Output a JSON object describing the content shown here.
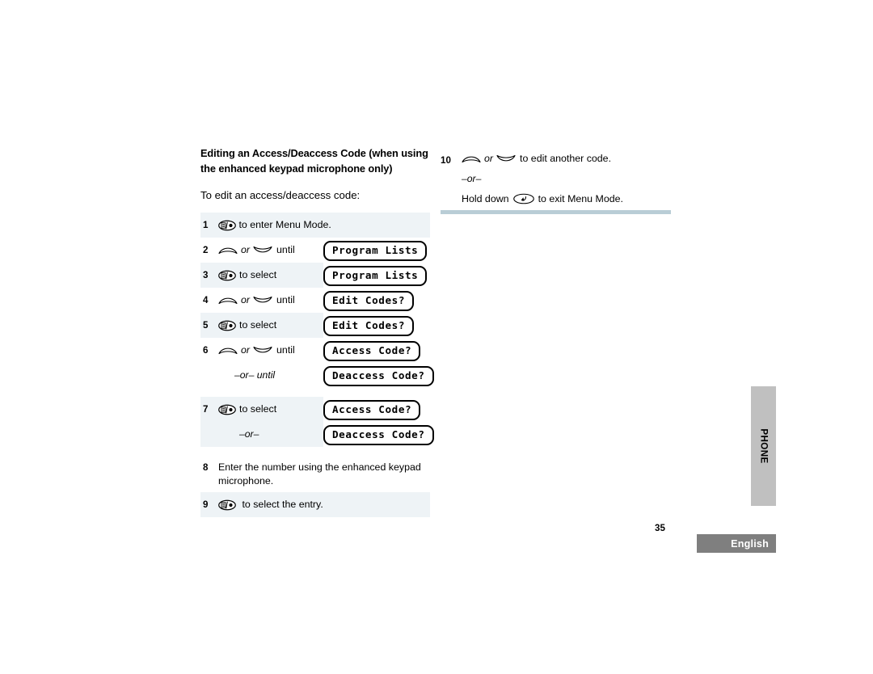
{
  "section": {
    "title": "Editing an Access/Deaccess Code (when using the enhanced keypad microphone only)",
    "intro": "To edit an access/deaccess code:"
  },
  "icons": {
    "menu_select": "menu-select-key-icon",
    "up": "up-arrow-key-icon",
    "down": "down-arrow-key-icon",
    "back": "back-exit-key-icon"
  },
  "labels": {
    "or_italic": "or",
    "or_dash": "–or–",
    "or_dash_until": "until"
  },
  "steps": [
    {
      "num": "1",
      "icon": "menu-select-key-icon",
      "text": "to enter Menu Mode.",
      "shaded": true,
      "full": true,
      "display": null
    },
    {
      "num": "2",
      "icon": "updown",
      "text": "until",
      "shaded": false,
      "display": "Program Lists"
    },
    {
      "num": "3",
      "icon": "menu-select-key-icon",
      "text": "to select",
      "shaded": true,
      "display": "Program Lists"
    },
    {
      "num": "4",
      "icon": "updown",
      "text": "until",
      "shaded": false,
      "display": "Edit Codes?"
    },
    {
      "num": "5",
      "icon": "menu-select-key-icon",
      "text": "to select",
      "shaded": true,
      "display": "Edit Codes?"
    },
    {
      "num": "6",
      "icon": "updown",
      "text": "until",
      "shaded": false,
      "display": "Access Code?",
      "alt_label": "–or– until",
      "alt_display": "Deaccess Code?"
    },
    {
      "num": "7",
      "icon": "menu-select-key-icon",
      "text": "to select",
      "shaded": true,
      "display": "Access Code?",
      "alt_label": "–or–",
      "alt_display": "Deaccess Code?"
    },
    {
      "num": "8",
      "icon": null,
      "text": "Enter the number using the enhanced keypad microphone.",
      "shaded": false,
      "full": true,
      "display": null
    },
    {
      "num": "9",
      "icon": "menu-select-key-icon",
      "text": "to select the entry.",
      "shaded": true,
      "full": true,
      "display": null
    }
  ],
  "right": {
    "num": "10",
    "text": "to edit another code.",
    "or_dash": "–or–",
    "hold_prefix": "Hold down",
    "hold_suffix": "to exit Menu Mode."
  },
  "side_tab": {
    "label": "PHONE"
  },
  "footer": {
    "page_number": "35",
    "language": "English"
  },
  "colors": {
    "row_shade": "#eef3f6",
    "rule": "#b9cdd6",
    "side_tab": "#c0c0c0",
    "lang_tab": "#7f7f7f"
  }
}
